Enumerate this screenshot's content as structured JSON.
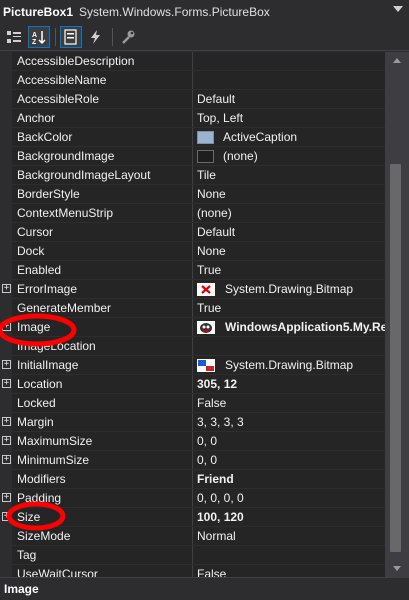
{
  "header": {
    "object_name": "PictureBox1",
    "object_type": "System.Windows.Forms.PictureBox"
  },
  "toolbar": {
    "buttons": [
      {
        "name": "categorized",
        "icon": "categorized-icon",
        "active": false
      },
      {
        "name": "alphabetical",
        "icon": "alphabetical-icon",
        "active": true
      },
      {
        "name": "properties",
        "icon": "properties-icon",
        "active": true
      },
      {
        "name": "events",
        "icon": "lightning-icon",
        "active": false
      },
      {
        "name": "property-pages",
        "icon": "wrench-icon",
        "active": false
      }
    ]
  },
  "properties": [
    {
      "name": "AccessibleDescription",
      "value": "",
      "expandable": false
    },
    {
      "name": "AccessibleName",
      "value": "",
      "expandable": false
    },
    {
      "name": "AccessibleRole",
      "value": "Default",
      "expandable": false
    },
    {
      "name": "Anchor",
      "value": "Top, Left",
      "expandable": false
    },
    {
      "name": "BackColor",
      "value": "ActiveCaption",
      "expandable": false,
      "swatch": "#99b4d1"
    },
    {
      "name": "BackgroundImage",
      "value": "(none)",
      "expandable": false,
      "swatch": "#1e1e1e"
    },
    {
      "name": "BackgroundImageLayout",
      "value": "Tile",
      "expandable": false
    },
    {
      "name": "BorderStyle",
      "value": "None",
      "expandable": false
    },
    {
      "name": "ContextMenuStrip",
      "value": "(none)",
      "expandable": false
    },
    {
      "name": "Cursor",
      "value": "Default",
      "expandable": false
    },
    {
      "name": "Dock",
      "value": "None",
      "expandable": false
    },
    {
      "name": "Enabled",
      "value": "True",
      "expandable": false
    },
    {
      "name": "ErrorImage",
      "value": "System.Drawing.Bitmap",
      "expandable": true,
      "thumb": "error"
    },
    {
      "name": "GenerateMember",
      "value": "True",
      "expandable": false
    },
    {
      "name": "Image",
      "value": "WindowsApplication5.My.Re",
      "expandable": true,
      "thumb": "image",
      "bold": true
    },
    {
      "name": "ImageLocation",
      "value": "",
      "expandable": false
    },
    {
      "name": "InitialImage",
      "value": "System.Drawing.Bitmap",
      "expandable": true,
      "thumb": "initial"
    },
    {
      "name": "Location",
      "value": "305, 12",
      "expandable": true,
      "bold": true
    },
    {
      "name": "Locked",
      "value": "False",
      "expandable": false
    },
    {
      "name": "Margin",
      "value": "3, 3, 3, 3",
      "expandable": true
    },
    {
      "name": "MaximumSize",
      "value": "0, 0",
      "expandable": true
    },
    {
      "name": "MinimumSize",
      "value": "0, 0",
      "expandable": true
    },
    {
      "name": "Modifiers",
      "value": "Friend",
      "expandable": false,
      "bold": true
    },
    {
      "name": "Padding",
      "value": "0, 0, 0, 0",
      "expandable": true
    },
    {
      "name": "Size",
      "value": "100, 120",
      "expandable": true,
      "bold": true
    },
    {
      "name": "SizeMode",
      "value": "Normal",
      "expandable": false
    },
    {
      "name": "Tag",
      "value": "",
      "expandable": false
    },
    {
      "name": "UseWaitCursor",
      "value": "False",
      "expandable": false
    }
  ],
  "description": {
    "title": "Image"
  },
  "colors": {
    "annotation": "#ff0000",
    "panel": "#2d2d30",
    "grid": "#252526"
  }
}
